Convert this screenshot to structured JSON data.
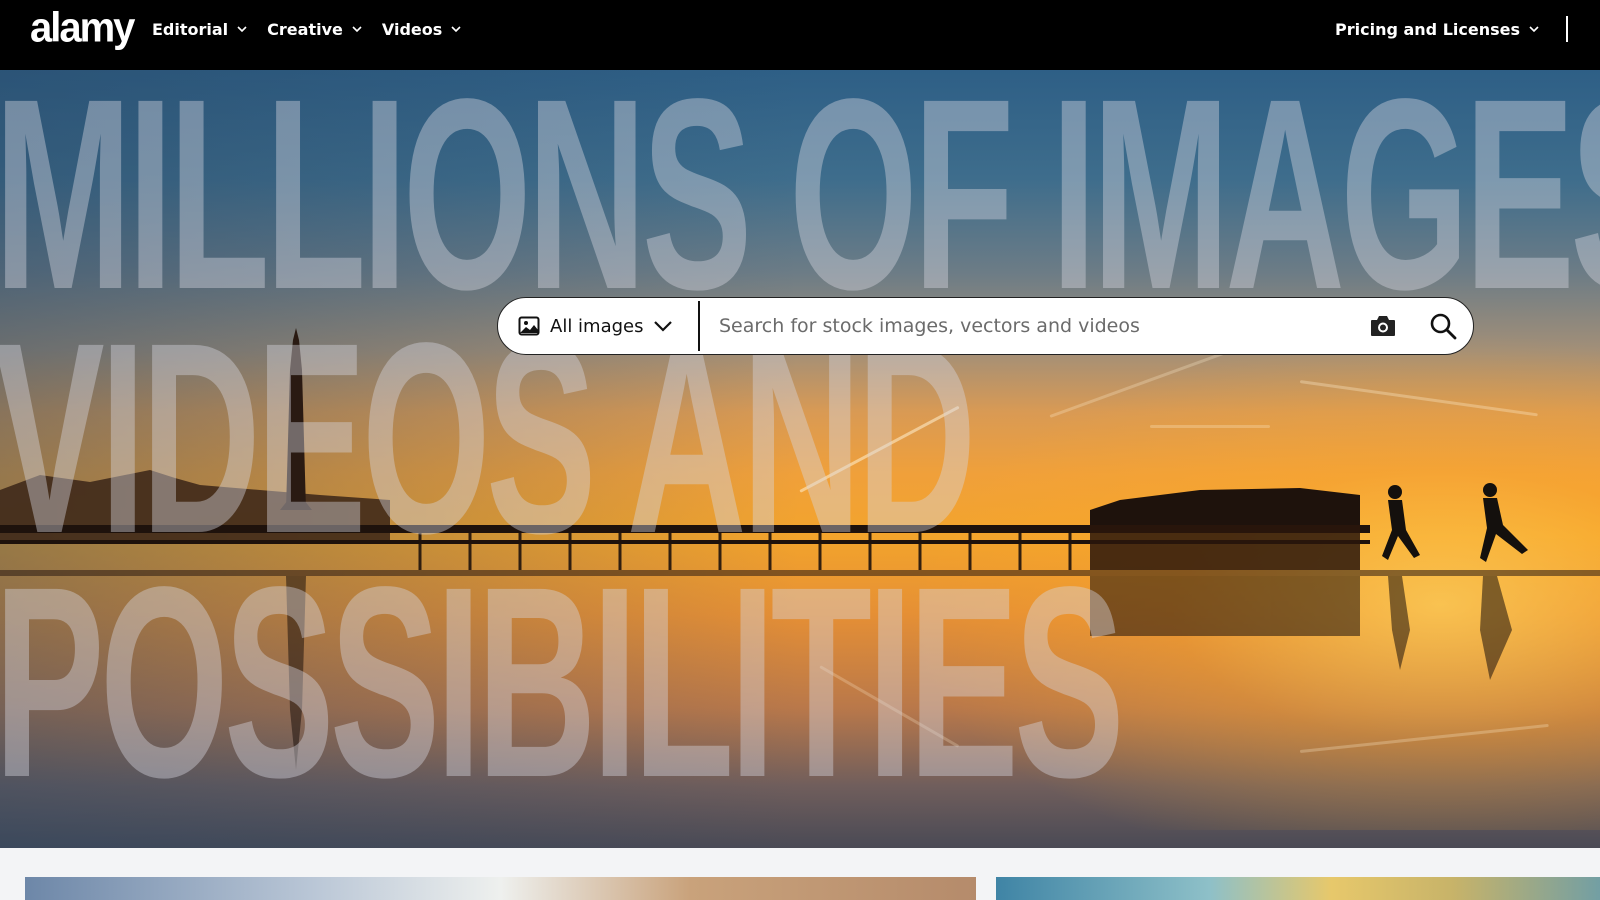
{
  "brand": {
    "logo_text": "alamy"
  },
  "nav": {
    "items": [
      {
        "label": "Editorial"
      },
      {
        "label": "Creative"
      },
      {
        "label": "Videos"
      }
    ],
    "right_label": "Pricing and Licenses"
  },
  "hero": {
    "line1": "MILLIONS OF IMAGES",
    "line2": "VIDEOS AND",
    "line3": "POSSIBILITIES"
  },
  "search": {
    "type_label": "All images",
    "placeholder": "Search for stock images, vectors and videos",
    "value": ""
  },
  "icons": {
    "type": "image-icon",
    "dropdown": "chevron-down-icon",
    "camera": "camera-icon",
    "search": "search-icon"
  },
  "colors": {
    "topbar": "#000000",
    "background": "#f3f4f6"
  }
}
